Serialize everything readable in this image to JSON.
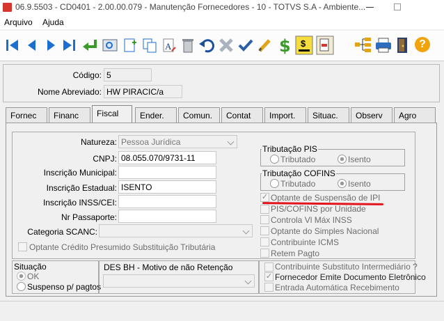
{
  "window": {
    "title": "06.9.5503 - CD0401 - 2.00.00.079 - Manutenção Fornecedores - 10 - TOTVS S.A - Ambiente..."
  },
  "menu": {
    "file": "Arquivo",
    "help": "Ajuda"
  },
  "header": {
    "codigo_label": "Código:",
    "codigo_value": "5",
    "nome_label": "Nome Abreviado:",
    "nome_value": "HW PIRACIC/a"
  },
  "tabs": [
    "Fornec",
    "Financ",
    "Fiscal",
    "Ender.",
    "Comun.",
    "Contat",
    "Import.",
    "Situac.",
    "Observ",
    "Agro"
  ],
  "fiscal": {
    "natureza_label": "Natureza:",
    "natureza_value": "Pessoa Jurídica",
    "cnpj_label": "CNPJ:",
    "cnpj_value": "08.055.070/9731-11",
    "ins_mun_label": "Inscrição Municipal:",
    "ins_mun_value": "",
    "ins_est_label": "Inscrição Estadual:",
    "ins_est_value": "ISENTO",
    "inss_label": "Inscrição INSS/CEI:",
    "inss_value": "",
    "passaporte_label": "Nr Passaporte:",
    "passaporte_value": "",
    "scanc_label": "Categoria SCANC:",
    "scanc_value": "",
    "opt_credito": "Optante Crédito Presumido Substituição Tributária",
    "trib_pis": {
      "title": "Tributação PIS",
      "opt1": "Tributado",
      "opt2": "Isento",
      "selected": "Isento"
    },
    "trib_cofins": {
      "title": "Tributação COFINS",
      "opt1": "Tributado",
      "opt2": "Isento",
      "selected": "Isento"
    },
    "checks": [
      {
        "label": "Optante de Suspensão de IPI",
        "checked": true
      },
      {
        "label": "PIS/COFINS por Unidade",
        "checked": false
      },
      {
        "label": "Controla Vl Máx INSS",
        "checked": false
      },
      {
        "label": "Optante do Simples Nacional",
        "checked": false
      },
      {
        "label": "Contribuinte ICMS",
        "checked": false
      },
      {
        "label": "Retem Pagto",
        "checked": false
      }
    ],
    "situacao": {
      "title": "Situação",
      "opt1": "OK",
      "opt2": "Suspenso p/ pagtos"
    },
    "des_bh": {
      "title": "DES BH - Motivo de não Retenção",
      "value": ""
    },
    "bottom_checks": [
      {
        "label": "Contribuinte Substituto Intermediário ?",
        "checked": false
      },
      {
        "label": "Fornecedor Emite Documento Eletrônico",
        "checked": true
      },
      {
        "label": "Entrada Automática Recebimento",
        "checked": false
      }
    ]
  },
  "colors": {
    "annotation": "#e3141b",
    "toolbar_blue": "#1a6fd0",
    "toolbar_green": "#3a9b2a"
  }
}
